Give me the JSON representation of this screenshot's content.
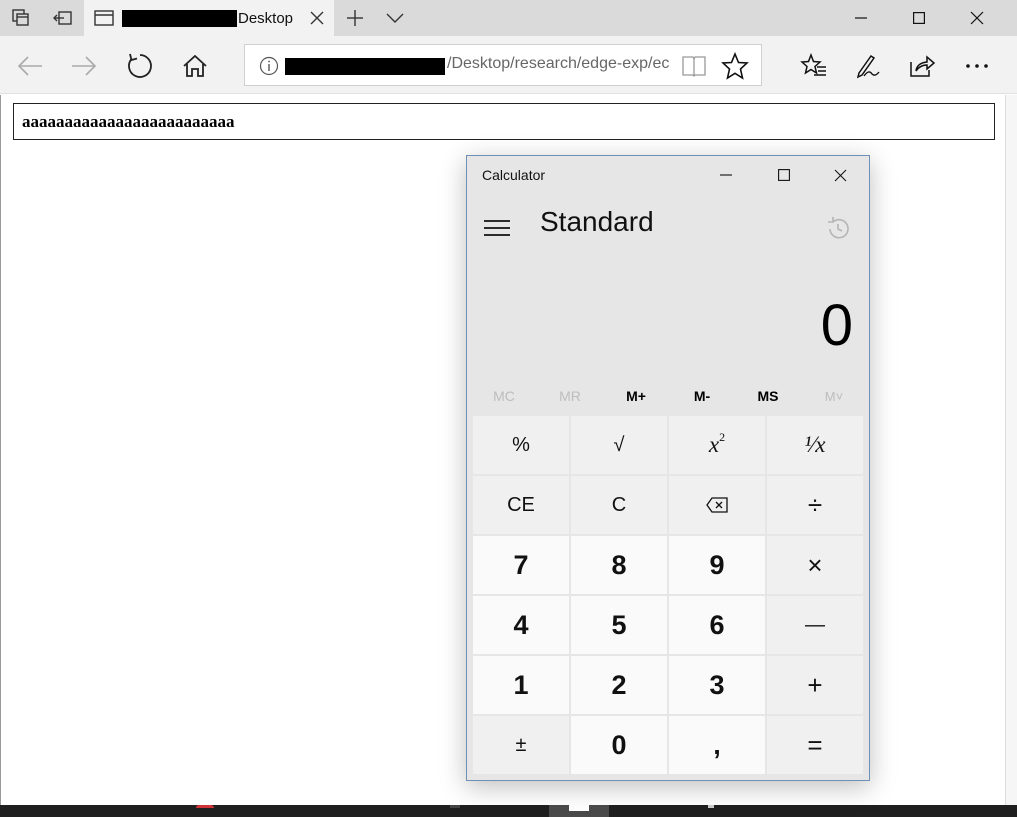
{
  "browser": {
    "tab_title": "Desktop",
    "url_visible": "/Desktop/research/edge-exp/ec"
  },
  "page": {
    "input_value": "aaaaaaaaaaaaaaaaaaaaaaaaa"
  },
  "calculator": {
    "window_title": "Calculator",
    "mode": "Standard",
    "display_value": "0",
    "memory_buttons": [
      {
        "label": "MC",
        "enabled": false
      },
      {
        "label": "MR",
        "enabled": false
      },
      {
        "label": "M+",
        "enabled": true
      },
      {
        "label": "M-",
        "enabled": true
      },
      {
        "label": "MS",
        "enabled": true
      },
      {
        "label": "M˅",
        "enabled": false
      }
    ],
    "keys": {
      "percent": "%",
      "sqrt": "√",
      "square": "x",
      "square_sup": "2",
      "reciprocal": "¹⁄x",
      "clear_entry": "CE",
      "clear": "C",
      "divide": "÷",
      "seven": "7",
      "eight": "8",
      "nine": "9",
      "multiply": "×",
      "four": "4",
      "five": "5",
      "six": "6",
      "minus": "—",
      "one": "1",
      "two": "2",
      "three": "3",
      "plus": "+",
      "negate": "±",
      "zero": "0",
      "decimal": ",",
      "equals": "="
    }
  },
  "icons": {
    "tab_manager": "tab-manager-icon",
    "set_aside": "set-aside-icon",
    "back": "back-arrow-icon",
    "forward": "forward-arrow-icon",
    "refresh": "refresh-icon",
    "home": "home-icon",
    "favorites": "favorites-icon",
    "pen": "pen-icon",
    "share": "share-icon",
    "more": "more-icon",
    "history": "history-icon"
  }
}
